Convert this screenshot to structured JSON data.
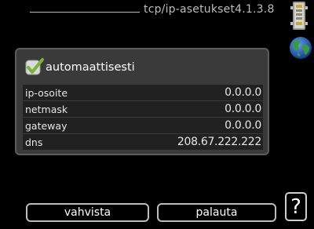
{
  "header": {
    "title": "tcp/ip-asetukset4.1.3.8"
  },
  "icons": {
    "device": "device-icon",
    "globe": "globe-icon",
    "check": "check-icon"
  },
  "settings": {
    "auto_label": "automaattisesti",
    "auto_checked": true,
    "rows": [
      {
        "label": "ip-osoite",
        "value": "0.0.0.0"
      },
      {
        "label": "netmask",
        "value": "0.0.0.0"
      },
      {
        "label": "gateway",
        "value": "0.0.0.0"
      },
      {
        "label": "dns",
        "value": "208.67.222.222"
      }
    ]
  },
  "buttons": {
    "confirm_label": "vahvista",
    "reset_label": "palauta",
    "help_label": "?"
  },
  "colors": {
    "background": "#000000",
    "panel": "#3a3a3a",
    "row": "#212121",
    "check_green": "#7ab33a"
  }
}
